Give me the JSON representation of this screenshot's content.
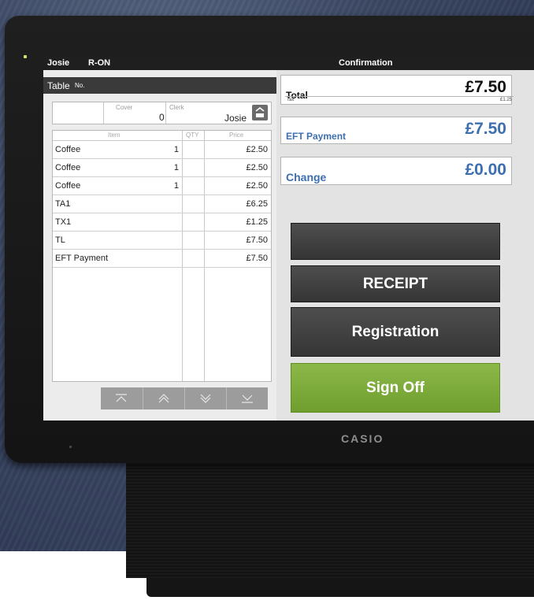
{
  "device": {
    "brand": "CASIO"
  },
  "topbar": {
    "user": "Josie",
    "mode": "R-ON",
    "title": "Confirmation"
  },
  "table_bar": {
    "label": "Table",
    "sub_label": "No."
  },
  "info": {
    "cover_label": "Cover",
    "cover_value": "0",
    "clerk_label": "Clerk",
    "clerk_value": "Josie"
  },
  "order": {
    "columns": [
      "Item",
      "QTY",
      "Price"
    ],
    "rows": [
      {
        "item": "Coffee",
        "qty": "1",
        "price": "£2.50"
      },
      {
        "item": "Coffee",
        "qty": "1",
        "price": "£2.50"
      },
      {
        "item": "Coffee",
        "qty": "1",
        "price": "£2.50"
      },
      {
        "item": "TA1",
        "qty": "",
        "price": "£6.25"
      },
      {
        "item": "TX1",
        "qty": "",
        "price": "£1.25"
      },
      {
        "item": "TL",
        "qty": "",
        "price": "£7.50"
      },
      {
        "item": "EFT Payment",
        "qty": "",
        "price": "£7.50"
      }
    ]
  },
  "summary": {
    "total_label": "Total",
    "total_value": "£7.50",
    "tax_label": "Tax",
    "tax_value": "£1.25",
    "payment_label": "EFT Payment",
    "payment_value": "£7.50",
    "change_label": "Change",
    "change_value": "£0.00"
  },
  "actions": {
    "blank_label": "",
    "receipt_label": "RECEIPT",
    "registration_label": "Registration",
    "signoff_label": "Sign Off"
  },
  "colors": {
    "accent_blue": "#3d6fb0",
    "signoff_green": "#7aab36",
    "topbar": "#1f1f1f"
  }
}
